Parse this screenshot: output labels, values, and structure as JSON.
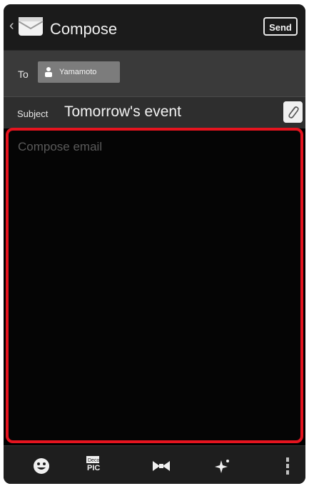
{
  "header": {
    "title": "Compose",
    "send_label": "Send"
  },
  "recipients": {
    "to_label": "To",
    "chips": [
      "Yamamoto"
    ]
  },
  "subject": {
    "label": "Subject",
    "value": "Tomorrow's event"
  },
  "body": {
    "placeholder": "Compose email"
  },
  "toolbar": {
    "items": [
      "smiley-icon",
      "deco-pic-icon",
      "bow-tie-icon",
      "sparkle-icon",
      "more-vert-icon"
    ],
    "deco_pic_label_top": "Deco",
    "deco_pic_label_bottom": "PIC"
  },
  "colors": {
    "highlight_border": "#e5141f",
    "header_bg": "#1b1b1b",
    "to_row_bg": "#3a3a3a",
    "chip_bg": "#7c7c7c"
  }
}
